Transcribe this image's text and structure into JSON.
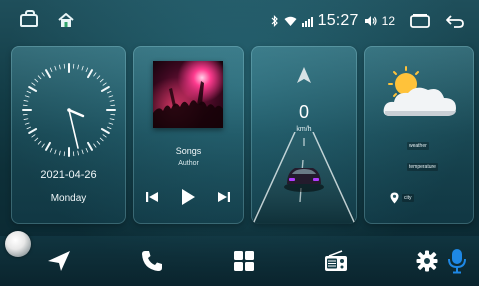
{
  "status_bar": {
    "time": "15:27",
    "volume": "12"
  },
  "clock_widget": {
    "date": "2021-04-26",
    "weekday": "Monday"
  },
  "music_widget": {
    "song": "Songs",
    "author": "Author"
  },
  "speed_widget": {
    "speed": "0",
    "unit": "km/h"
  },
  "weather_widget": {
    "weather": "weather",
    "temperature": "temperature",
    "city": "city"
  },
  "dock": {
    "items": [
      "navigation-icon",
      "phone-icon",
      "apps-icon",
      "radio-icon",
      "settings-icon",
      "microphone-icon"
    ]
  },
  "colors": {
    "accent": "#1e88e5",
    "text": "#ffffff",
    "card": "#5fb4c4"
  }
}
